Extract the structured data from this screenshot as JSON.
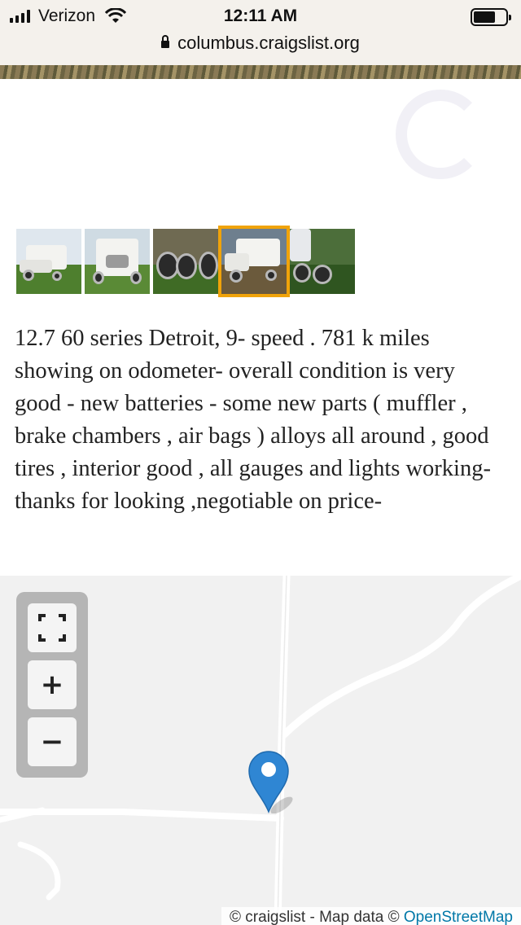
{
  "status_bar": {
    "carrier": "Verizon",
    "time": "12:11 AM"
  },
  "browser": {
    "url": "columbus.craigslist.org"
  },
  "gallery": {
    "thumbnails": [
      {
        "name": "truck-front-side"
      },
      {
        "name": "truck-front"
      },
      {
        "name": "rear-wheels"
      },
      {
        "name": "truck-side",
        "selected": true
      },
      {
        "name": "chassis-rear"
      }
    ],
    "selected_index": 3,
    "selected_border_color": "#f0a30a"
  },
  "posting": {
    "description": "12.7 60 series Detroit, 9- speed . 781 k miles showing on odometer- overall condition is very good - new batteries - some new parts ( muffler , brake chambers , air bags ) alloys all around , good tires , interior good , all gauges and lights working- thanks for looking ,negotiable on price-"
  },
  "map": {
    "controls": {
      "fullscreen_icon": "fullscreen-icon",
      "zoom_in": "+",
      "zoom_out": "−"
    },
    "marker_color": "#2f86d3",
    "attribution": {
      "prefix": "© craigslist - Map data © ",
      "link": "OpenStreetMap"
    }
  }
}
